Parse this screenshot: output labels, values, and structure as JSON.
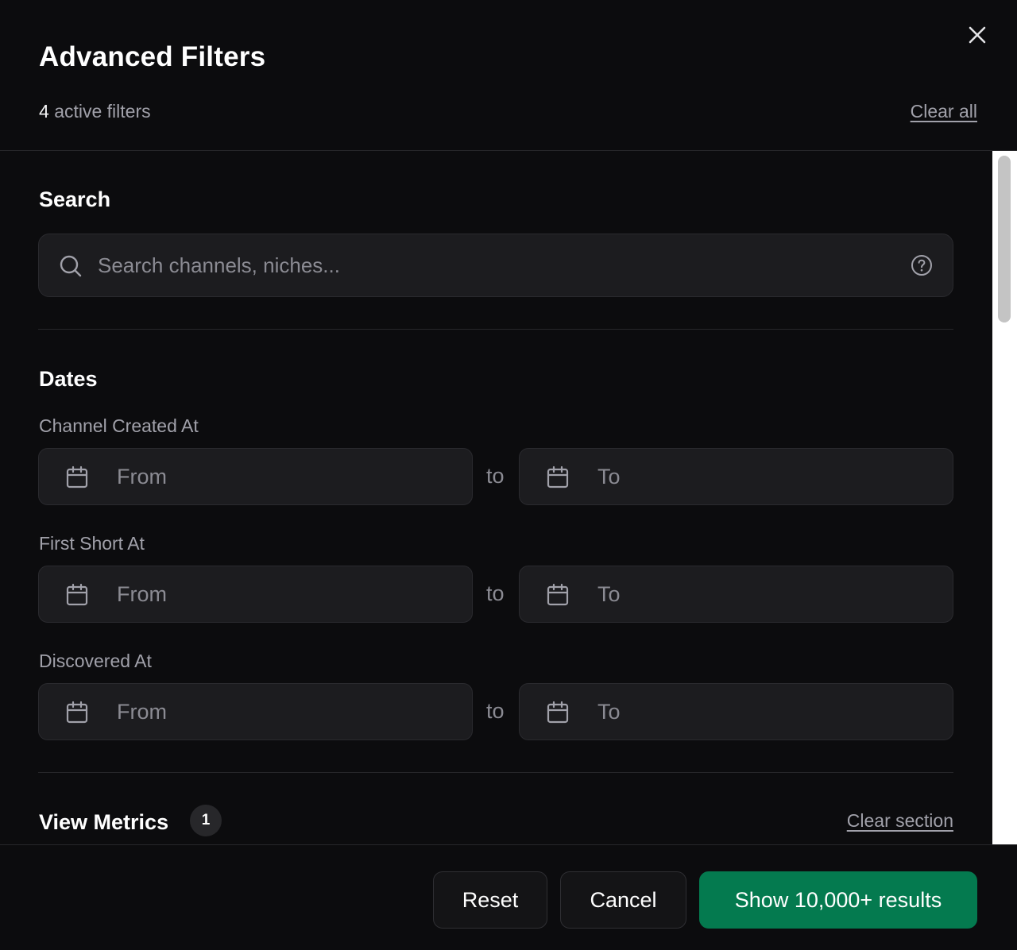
{
  "header": {
    "title": "Advanced Filters",
    "active_count": "4",
    "active_suffix": "active filters",
    "clear_all_label": "Clear all"
  },
  "icons": {
    "close": "close-icon",
    "search": "search-icon",
    "help": "help-circle-icon",
    "calendar": "calendar-icon"
  },
  "search_section": {
    "title": "Search",
    "placeholder": "Search channels, niches..."
  },
  "dates_section": {
    "title": "Dates",
    "separator": "to",
    "fields": [
      {
        "label": "Channel Created At",
        "from_placeholder": "From",
        "to_placeholder": "To"
      },
      {
        "label": "First Short At",
        "from_placeholder": "From",
        "to_placeholder": "To"
      },
      {
        "label": "Discovered At",
        "from_placeholder": "From",
        "to_placeholder": "To"
      }
    ]
  },
  "view_metrics_section": {
    "title": "View Metrics",
    "badge_count": "1",
    "clear_section_label": "Clear section"
  },
  "footer": {
    "reset_label": "Reset",
    "cancel_label": "Cancel",
    "show_results_label": "Show 10,000+ results"
  },
  "colors": {
    "background": "#0c0c0e",
    "input_bg": "#1c1c1f",
    "primary_button": "#047a4f",
    "muted_text": "#a1a1aa"
  }
}
